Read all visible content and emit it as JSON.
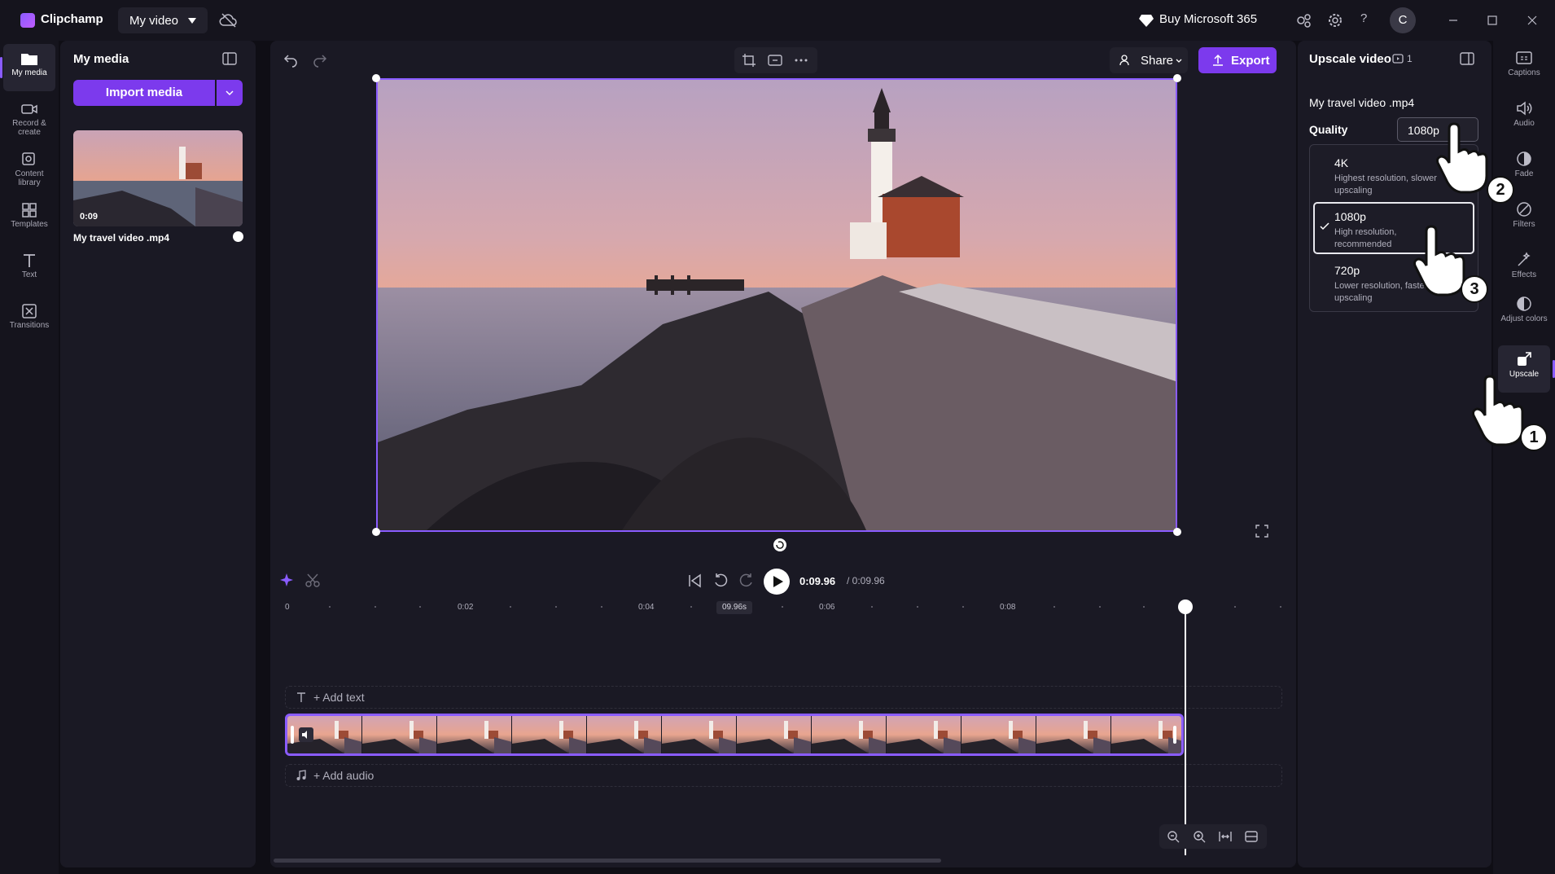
{
  "app": {
    "name": "Clipchamp",
    "project_title": "My video",
    "buy_label": "Buy Microsoft 365",
    "avatar_initial": "C"
  },
  "left_nav": [
    {
      "label": "My media",
      "icon": "folder-icon"
    },
    {
      "label": "Record & create",
      "icon": "camera-icon"
    },
    {
      "label": "Content library",
      "icon": "library-icon"
    },
    {
      "label": "Templates",
      "icon": "templates-icon"
    },
    {
      "label": "Text",
      "icon": "text-icon"
    },
    {
      "label": "Transitions",
      "icon": "transitions-icon"
    }
  ],
  "media_panel": {
    "title": "My media",
    "import_label": "Import media",
    "items": [
      {
        "name": "My travel video .mp4",
        "duration": "0:09"
      }
    ]
  },
  "editor": {
    "share_label": "Share",
    "export_label": "Export",
    "current_time": "0:09.96",
    "total_time": "/ 0:09.96",
    "ruler_labels": [
      "0",
      "0:02",
      "0:04",
      "0:06",
      "0:08"
    ],
    "ruler_badge": "09.96s",
    "add_text_label": "+ Add text",
    "add_audio_label": "+ Add audio"
  },
  "props": {
    "title": "Upscale video",
    "badge_count": "1",
    "file_name": "My travel video .mp4",
    "quality_label": "Quality",
    "quality_value": "1080p",
    "options": [
      {
        "title": "4K",
        "desc": "Highest resolution, slower upscaling"
      },
      {
        "title": "1080p",
        "desc": "High resolution, recommended",
        "selected": true
      },
      {
        "title": "720p",
        "desc": "Lower resolution, faster upscaling"
      }
    ]
  },
  "right_nav": [
    {
      "label": "Captions",
      "icon": "captions-icon"
    },
    {
      "label": "Audio",
      "icon": "speaker-icon"
    },
    {
      "label": "Fade",
      "icon": "fade-icon"
    },
    {
      "label": "Filters",
      "icon": "filters-icon"
    },
    {
      "label": "Effects",
      "icon": "effects-icon"
    },
    {
      "label": "Adjust colors",
      "icon": "adjust-colors-icon"
    },
    {
      "label": "Upscale",
      "icon": "upscale-icon"
    }
  ],
  "steps": [
    "1",
    "2",
    "3"
  ],
  "colors": {
    "accent": "#7c3aed",
    "selection": "#8a5cff",
    "panel": "#1a1924"
  }
}
